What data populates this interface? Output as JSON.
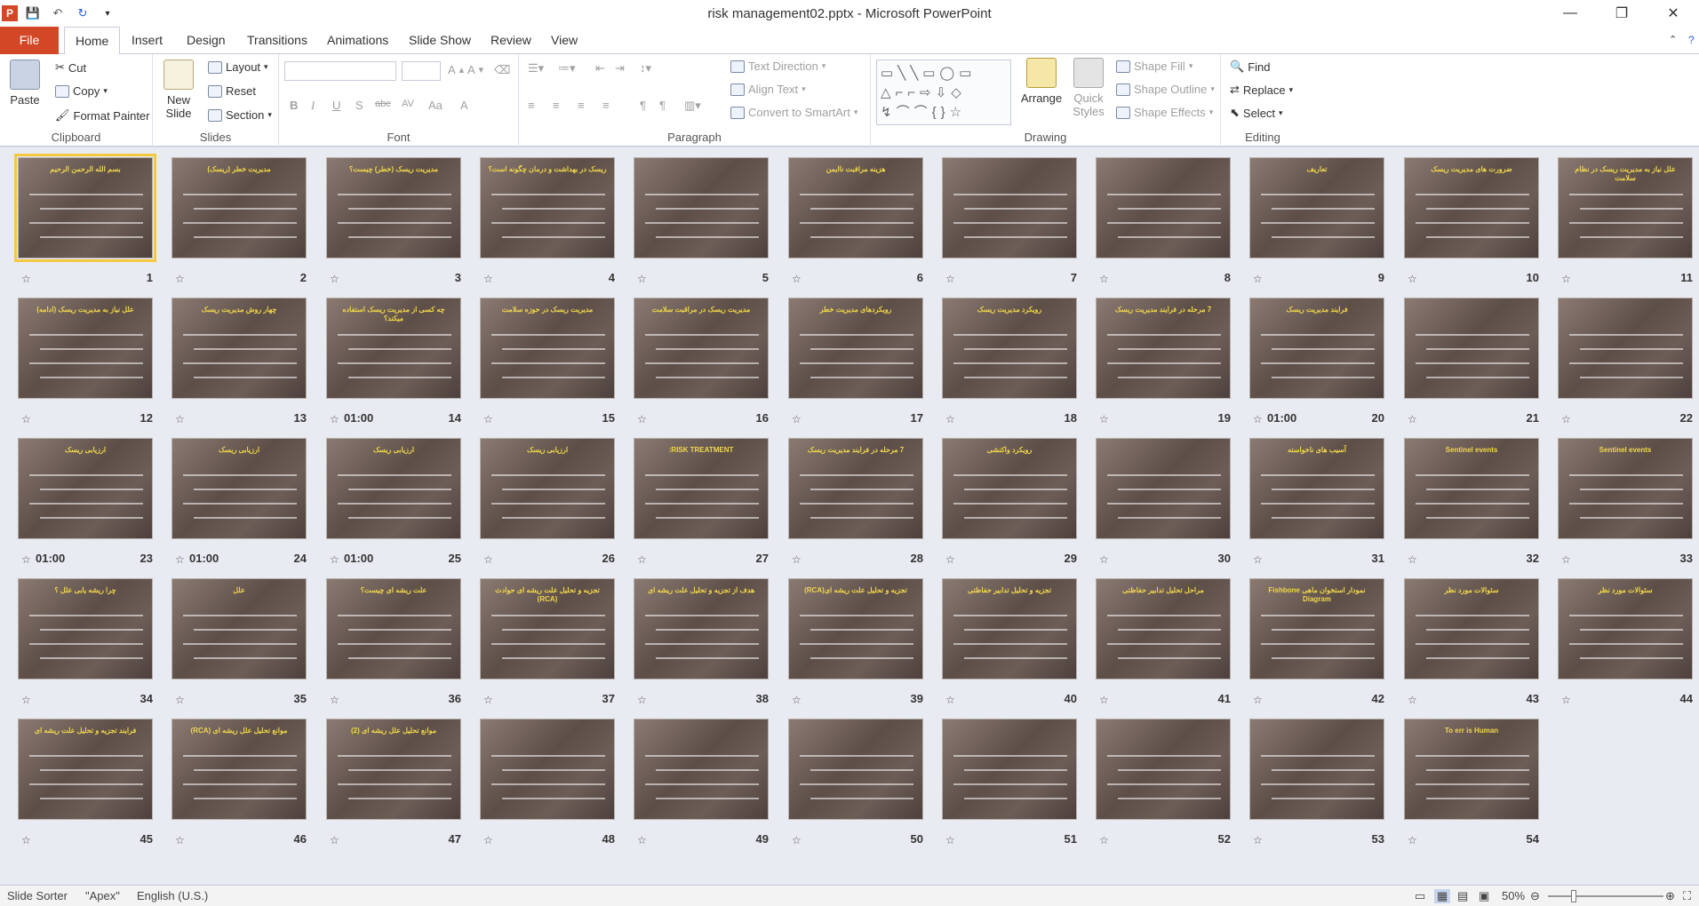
{
  "window": {
    "title": "risk management02.pptx - Microsoft PowerPoint",
    "minimize": "—",
    "maximize": "❐",
    "close": "✕"
  },
  "tabs": [
    "File",
    "Home",
    "Insert",
    "Design",
    "Transitions",
    "Animations",
    "Slide Show",
    "Review",
    "View"
  ],
  "ribbon": {
    "clipboard": {
      "label": "Clipboard",
      "paste": "Paste",
      "cut": "Cut",
      "copy": "Copy",
      "format_painter": "Format Painter"
    },
    "slides": {
      "label": "Slides",
      "new_slide": "New Slide",
      "layout": "Layout",
      "reset": "Reset",
      "section": "Section"
    },
    "font": {
      "label": "Font",
      "bold": "B",
      "italic": "I",
      "underline": "U",
      "shadow": "S",
      "strike": "abc",
      "spacing": "AV",
      "case": "Aa",
      "color": "A"
    },
    "paragraph": {
      "label": "Paragraph",
      "text_direction": "Text Direction",
      "align_text": "Align Text",
      "convert_smartart": "Convert to SmartArt"
    },
    "drawing": {
      "label": "Drawing",
      "arrange": "Arrange",
      "quick_styles": "Quick Styles",
      "shape_fill": "Shape Fill",
      "shape_outline": "Shape Outline",
      "shape_effects": "Shape Effects"
    },
    "editing": {
      "label": "Editing",
      "find": "Find",
      "replace": "Replace",
      "select": "Select"
    }
  },
  "slides": [
    {
      "n": "1",
      "title": "بسم الله الرحمن الرحیم",
      "timing": ""
    },
    {
      "n": "2",
      "title": "مدیریت خطر (ریسک)",
      "timing": ""
    },
    {
      "n": "3",
      "title": "مدیریت ریسک (خطر) چیست؟",
      "timing": ""
    },
    {
      "n": "4",
      "title": "ریسک در بهداشت و درمان چگونه است؟",
      "timing": ""
    },
    {
      "n": "5",
      "title": "",
      "timing": ""
    },
    {
      "n": "6",
      "title": "هزینه مراقبت ناایمن",
      "timing": ""
    },
    {
      "n": "7",
      "title": "",
      "timing": ""
    },
    {
      "n": "8",
      "title": "",
      "timing": ""
    },
    {
      "n": "9",
      "title": "تعاریف",
      "timing": ""
    },
    {
      "n": "10",
      "title": "ضرورت های مدیریت ریسک",
      "timing": ""
    },
    {
      "n": "11",
      "title": "علل نیاز به مدیریت ریسک در نظام سلامت",
      "timing": ""
    },
    {
      "n": "12",
      "title": "علل نیاز به مدیریت ریسک (ادامه)",
      "timing": ""
    },
    {
      "n": "13",
      "title": "چهار روش مدیریت ریسک",
      "timing": ""
    },
    {
      "n": "14",
      "title": "چه کسی از مدیریت ریسک استفاده میکند؟",
      "timing": "01:00"
    },
    {
      "n": "15",
      "title": "مدیریت ریسک در حوزه سلامت",
      "timing": ""
    },
    {
      "n": "16",
      "title": "مدیریت ریسک در مراقبت سلامت",
      "timing": ""
    },
    {
      "n": "17",
      "title": "رویکردهای مدیریت خطر",
      "timing": ""
    },
    {
      "n": "18",
      "title": "رویکرد مدیریت ریسک",
      "timing": ""
    },
    {
      "n": "19",
      "title": "7 مرحله در فرایند مدیریت ریسک",
      "timing": ""
    },
    {
      "n": "20",
      "title": "فرایند مدیریت ریسک",
      "timing": "01:00"
    },
    {
      "n": "21",
      "title": "",
      "timing": ""
    },
    {
      "n": "22",
      "title": "",
      "timing": ""
    },
    {
      "n": "23",
      "title": "ارزیابی ریسک",
      "timing": "01:00"
    },
    {
      "n": "24",
      "title": "ارزیابی ریسک",
      "timing": "01:00"
    },
    {
      "n": "25",
      "title": "ارزیابی ریسک",
      "timing": "01:00"
    },
    {
      "n": "26",
      "title": "ارزیابی ریسک",
      "timing": ""
    },
    {
      "n": "27",
      "title": "RISK TREATMENT:",
      "timing": ""
    },
    {
      "n": "28",
      "title": "7 مرحله در فرایند مدیریت ریسک",
      "timing": ""
    },
    {
      "n": "29",
      "title": "رویکرد واکنشی",
      "timing": ""
    },
    {
      "n": "30",
      "title": "",
      "timing": ""
    },
    {
      "n": "31",
      "title": "آسیب های ناخواسته",
      "timing": ""
    },
    {
      "n": "32",
      "title": "Sentinel events",
      "timing": ""
    },
    {
      "n": "33",
      "title": "Sentinel events",
      "timing": ""
    },
    {
      "n": "34",
      "title": "چرا ریشه یابی علل ؟",
      "timing": ""
    },
    {
      "n": "35",
      "title": "علل",
      "timing": ""
    },
    {
      "n": "36",
      "title": "علت ریشه ای چیست؟",
      "timing": ""
    },
    {
      "n": "37",
      "title": "تجزیه و تحلیل علت ریشه ای حوادث (RCA)",
      "timing": ""
    },
    {
      "n": "38",
      "title": "هدف از تجزیه و تحلیل علت ریشه ای",
      "timing": ""
    },
    {
      "n": "39",
      "title": "تجزیه و تحلیل علت ریشه ای(RCA)",
      "timing": ""
    },
    {
      "n": "40",
      "title": "تجزیه و تحلیل تدابیر حفاظتی",
      "timing": ""
    },
    {
      "n": "41",
      "title": "مراحل تحلیل تدابیر حفاظتی",
      "timing": ""
    },
    {
      "n": "42",
      "title": "نمودار استخوان ماهی Fishbone Diagram",
      "timing": ""
    },
    {
      "n": "43",
      "title": "سئوالات مورد نظر",
      "timing": ""
    },
    {
      "n": "44",
      "title": "سئوالات مورد نظر",
      "timing": ""
    },
    {
      "n": "45",
      "title": "فرایند تجزیه و تحلیل علت ریشه ای",
      "timing": ""
    },
    {
      "n": "46",
      "title": "موانع تحلیل علل ریشه ای (RCA)",
      "timing": ""
    },
    {
      "n": "47",
      "title": "موانع تحلیل علل ریشه ای (2)",
      "timing": ""
    },
    {
      "n": "48",
      "title": "",
      "timing": ""
    },
    {
      "n": "49",
      "title": "",
      "timing": ""
    },
    {
      "n": "50",
      "title": "",
      "timing": ""
    },
    {
      "n": "51",
      "title": "",
      "timing": ""
    },
    {
      "n": "52",
      "title": "",
      "timing": ""
    },
    {
      "n": "53",
      "title": "",
      "timing": ""
    },
    {
      "n": "54",
      "title": "To err is Human",
      "timing": ""
    }
  ],
  "status": {
    "view": "Slide Sorter",
    "theme": "\"Apex\"",
    "language": "English (U.S.)",
    "zoom": "50%"
  }
}
